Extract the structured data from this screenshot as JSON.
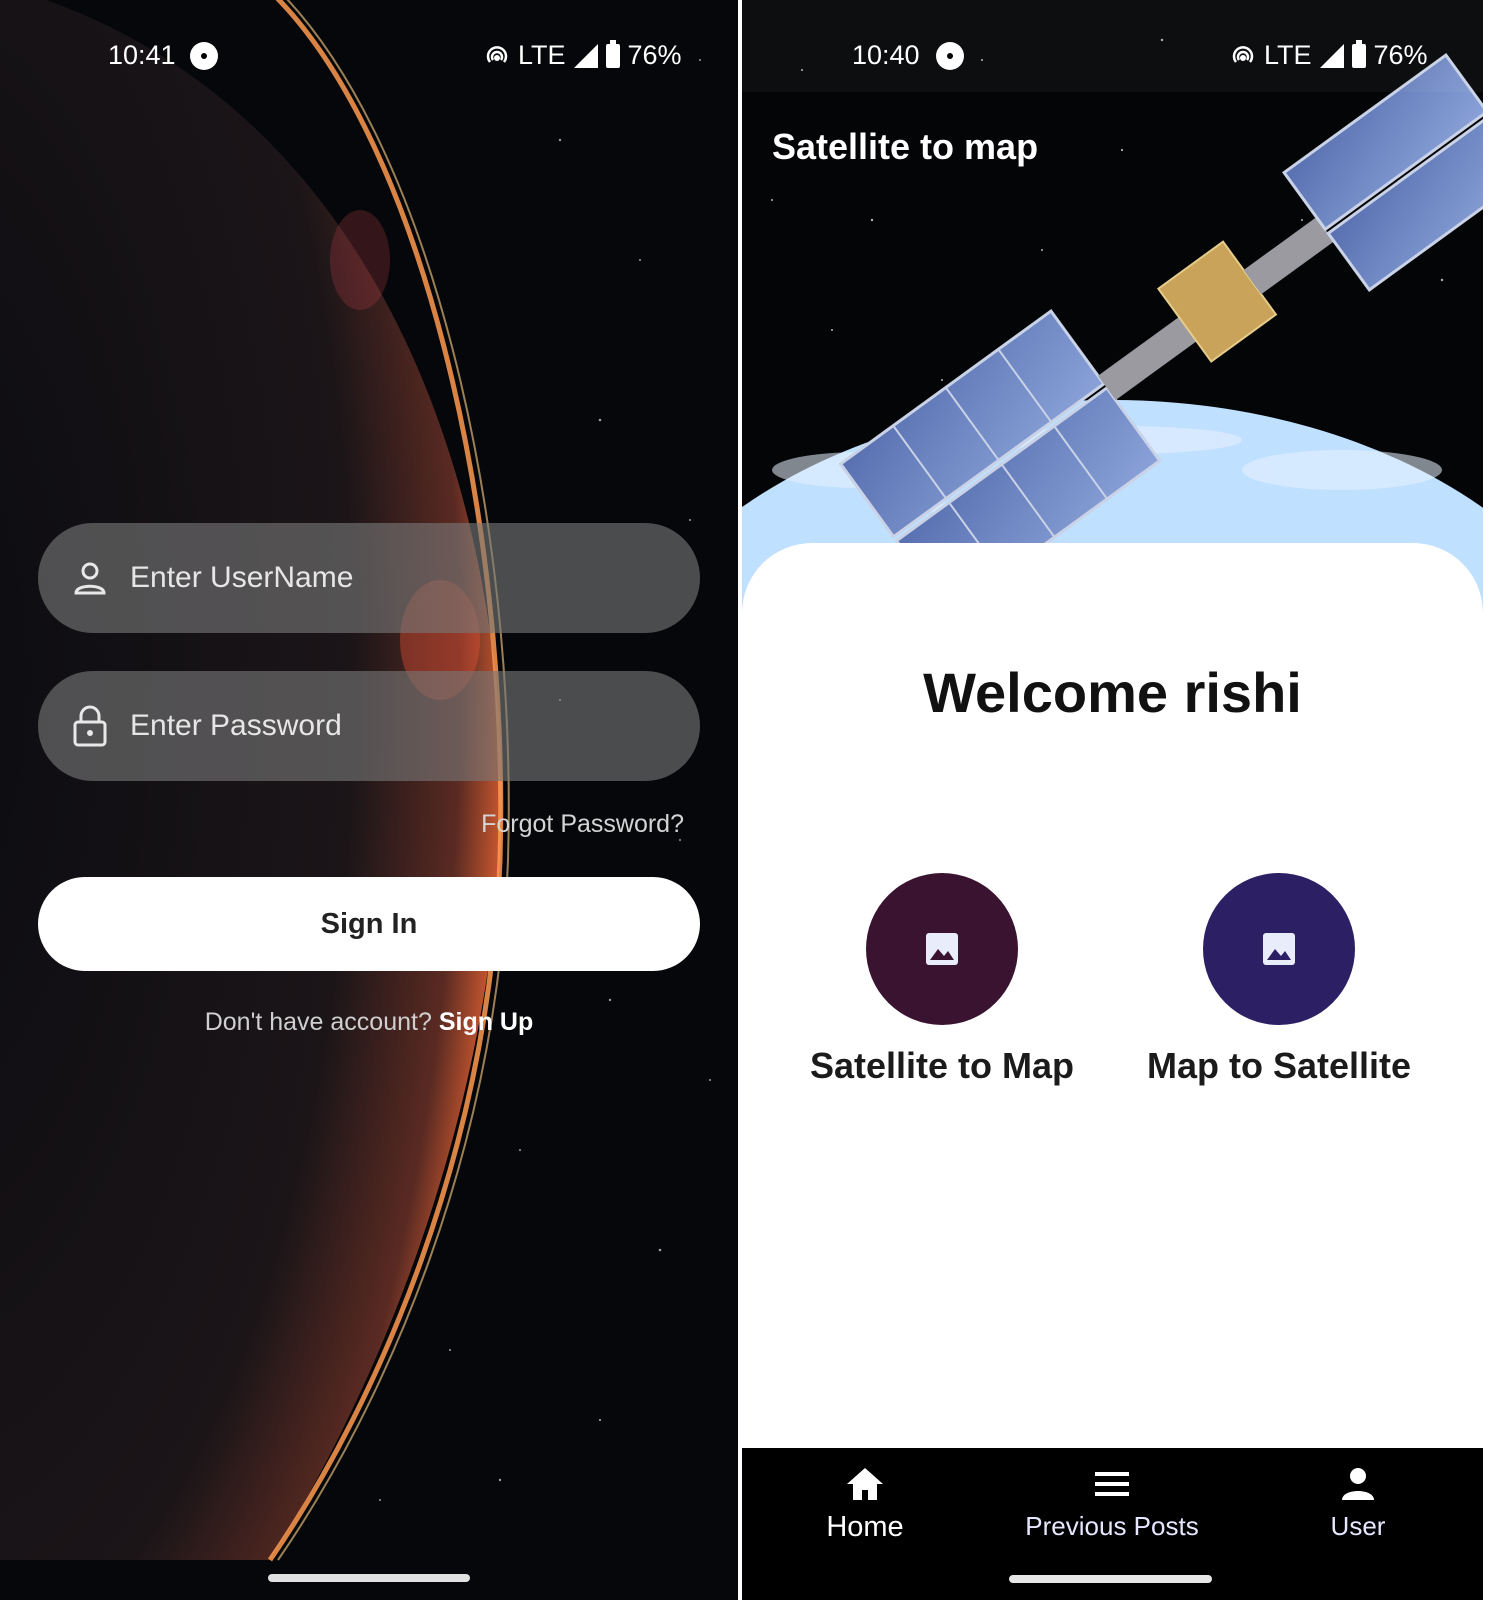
{
  "login": {
    "status": {
      "time": "10:41",
      "network": "LTE",
      "battery": "76%"
    },
    "username": {
      "placeholder": "Enter UserName"
    },
    "password": {
      "placeholder": "Enter Password"
    },
    "forgot_label": "Forgot Password?",
    "signin_label": "Sign In",
    "signup_prompt": "Don't have account?",
    "signup_link": "Sign Up"
  },
  "home": {
    "status": {
      "time": "10:40",
      "network": "LTE",
      "battery": "76%"
    },
    "app_title": "Satellite to map",
    "welcome": "Welcome rishi",
    "actions": [
      {
        "label": "Satellite to Map",
        "color": "#3a1330",
        "icon": "image-icon"
      },
      {
        "label": "Map to Satellite",
        "color": "#2c1f63",
        "icon": "image-icon"
      }
    ],
    "nav": [
      {
        "label": "Home",
        "icon": "home-icon",
        "active": true
      },
      {
        "label": "Previous Posts",
        "icon": "menu-icon",
        "active": false
      },
      {
        "label": "User",
        "icon": "person-icon",
        "active": false
      }
    ]
  }
}
